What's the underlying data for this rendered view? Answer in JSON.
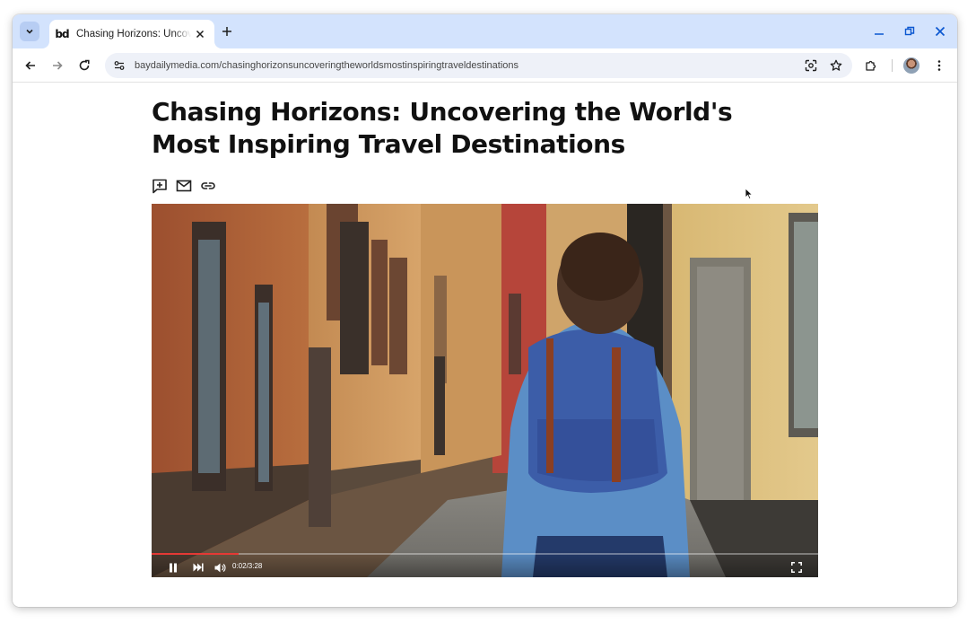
{
  "tab": {
    "title": "Chasing Horizons: Uncovering the World's Most Inspiring Travel Destinations",
    "favicon_text": "bd",
    "favicon_icon": "bd-logo"
  },
  "toolbar": {
    "url": "baydailymedia.com/chasinghorizonsuncoveringtheworldsmostinspiringtraveldestinations"
  },
  "article": {
    "headline": "Chasing Horizons: Uncovering the World's Most Inspiring Travel Destinations",
    "share_icons": [
      "comment-add-icon",
      "mail-icon",
      "link-icon"
    ]
  },
  "video": {
    "time": "0:02/3:28",
    "progress": 0.13,
    "progress_color": "#e53935",
    "state": "playing"
  },
  "colors": {
    "tabstrip": "#d3e3fd",
    "omnibox": "#eef1f8",
    "accent": "#0b57d0"
  }
}
